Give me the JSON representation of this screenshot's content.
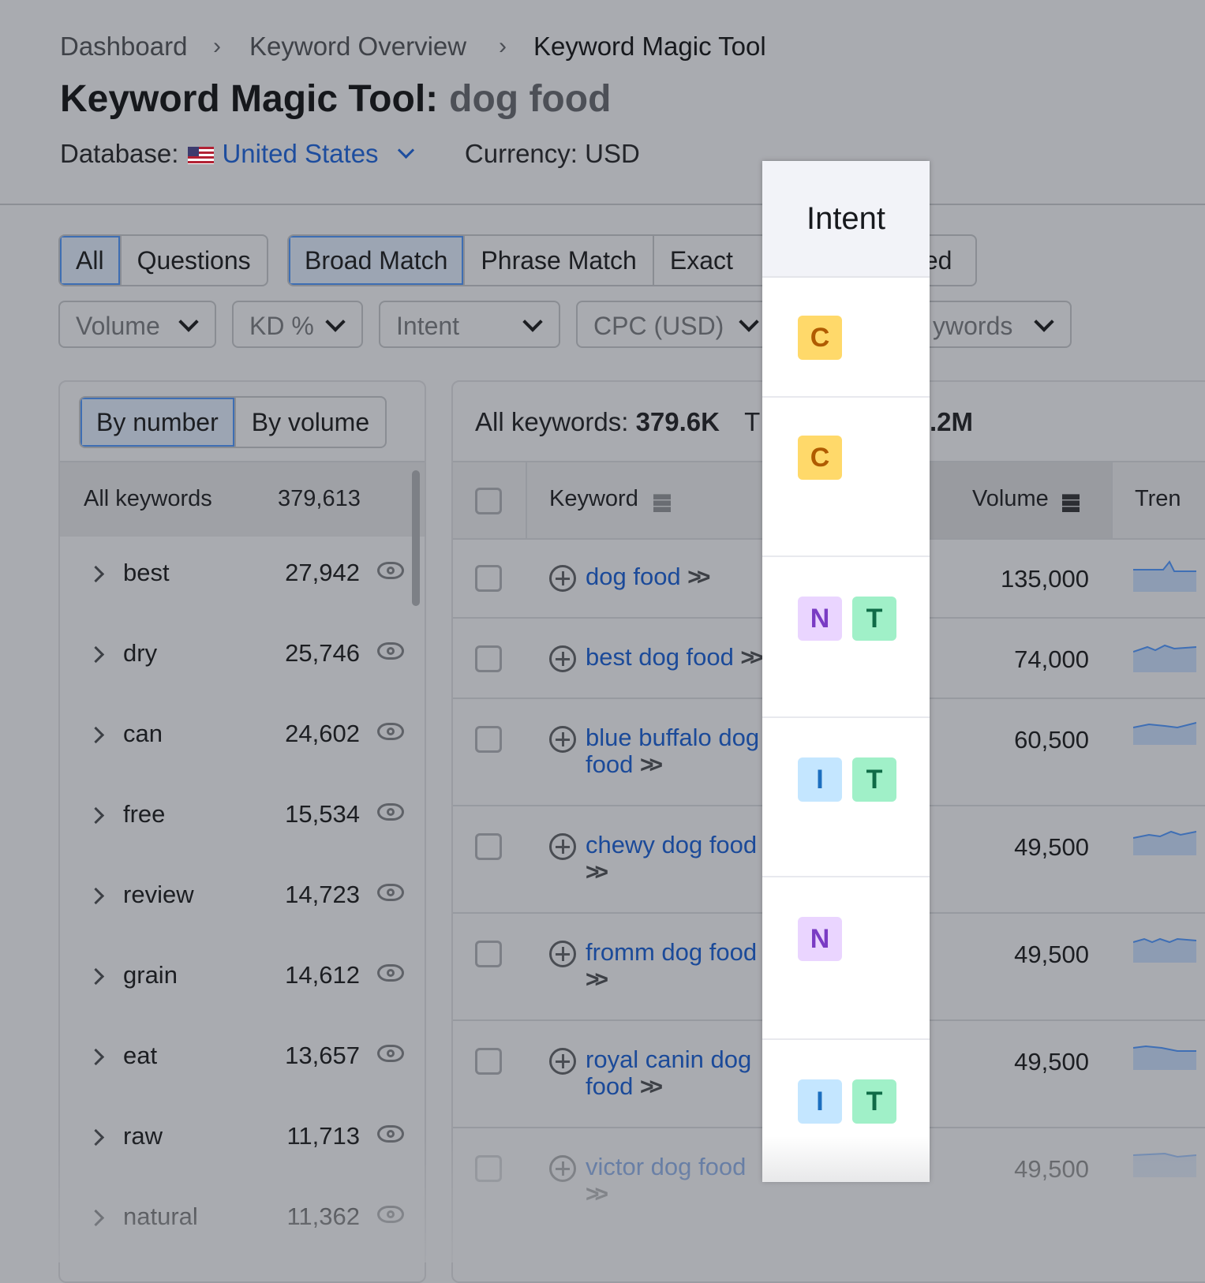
{
  "breadcrumb": [
    "Dashboard",
    "Keyword Overview",
    "Keyword Magic Tool"
  ],
  "page_title": {
    "tool": "Keyword Magic Tool:",
    "query": "dog food"
  },
  "database": {
    "label": "Database:",
    "country": "United States",
    "currency": "Currency: USD"
  },
  "match_tabs": {
    "group1": [
      "All",
      "Questions"
    ],
    "group2": [
      "Broad Match",
      "Phrase Match",
      "Exact",
      "ed"
    ],
    "selected": [
      "All",
      "Broad Match"
    ]
  },
  "filters": [
    "Volume",
    "KD %",
    "Intent",
    "CPC (USD)",
    "ywords"
  ],
  "sidebar": {
    "toggle": [
      "By number",
      "By volume"
    ],
    "all_label": "All keywords",
    "all_count": "379,613",
    "groups": [
      {
        "word": "best",
        "count": "27,942"
      },
      {
        "word": "dry",
        "count": "25,746"
      },
      {
        "word": "can",
        "count": "24,602"
      },
      {
        "word": "free",
        "count": "15,534"
      },
      {
        "word": "review",
        "count": "14,723"
      },
      {
        "word": "grain",
        "count": "14,612"
      },
      {
        "word": "eat",
        "count": "13,657"
      },
      {
        "word": "raw",
        "count": "11,713"
      },
      {
        "word": "natural",
        "count": "11,362"
      }
    ]
  },
  "results": {
    "summary_label": "All keywords:",
    "summary_value": "379.6K",
    "summary_tail_left": "T",
    "summary_tail_right": ".2M",
    "columns": {
      "keyword": "Keyword",
      "volume": "Volume",
      "trend": "Tren"
    },
    "rows": [
      {
        "line1": "dog food",
        "line2": "",
        "volume": "135,000"
      },
      {
        "line1": "best dog food",
        "line2": "",
        "volume": "74,000"
      },
      {
        "line1": "blue buffalo dog",
        "line2": "food",
        "volume": "60,500"
      },
      {
        "line1": "chewy dog food",
        "line2": "",
        "volume": "49,500"
      },
      {
        "line1": "fromm dog food",
        "line2": "",
        "volume": "49,500"
      },
      {
        "line1": "royal canin dog",
        "line2": "food",
        "volume": "49,500"
      },
      {
        "line1": "victor dog food",
        "line2": "",
        "volume": "49,500"
      }
    ]
  },
  "intent_column": {
    "header": "Intent",
    "rows": [
      [
        "C"
      ],
      [
        "C"
      ],
      [
        "N",
        "T"
      ],
      [
        "I",
        "T"
      ],
      [
        "N"
      ],
      [
        "I",
        "T"
      ]
    ]
  },
  "icons": {
    "eye": "eye-icon",
    "add": "plus-circle-icon",
    "more": "double-chevron-icon",
    "sort": "sort-icon"
  },
  "colors": {
    "link": "#1d4d9e",
    "badge_C": "#ffd96a",
    "badge_N": "#ead5ff",
    "badge_T": "#a0f0c8",
    "badge_I": "#c4e6ff"
  }
}
